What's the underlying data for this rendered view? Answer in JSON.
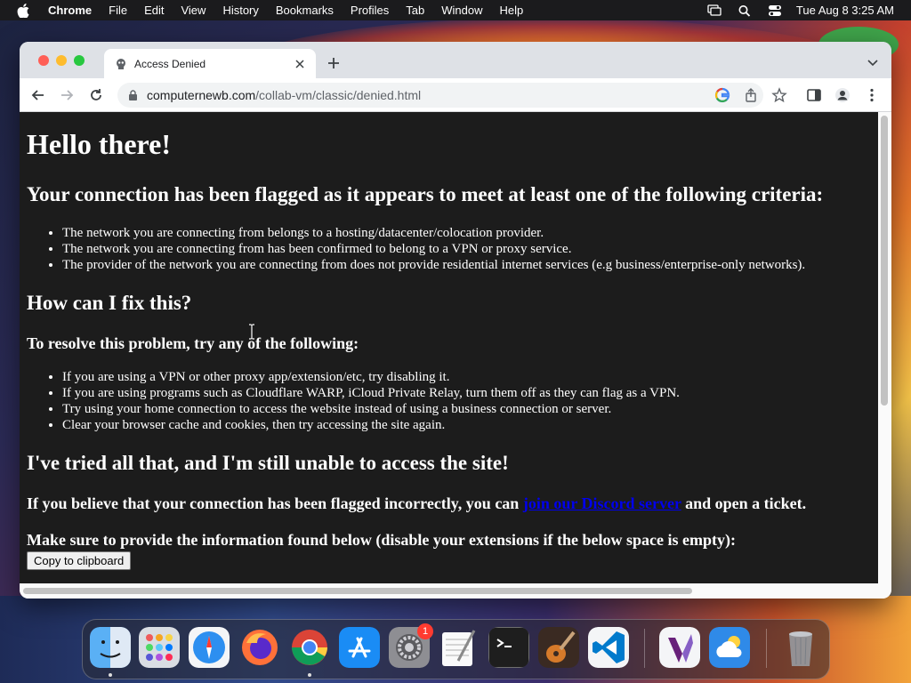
{
  "menubar": {
    "app_name": "Chrome",
    "items": [
      "File",
      "Edit",
      "View",
      "History",
      "Bookmarks",
      "Profiles",
      "Tab",
      "Window",
      "Help"
    ],
    "clock": "Tue Aug 8  3:25 AM"
  },
  "browser": {
    "tab_title": "Access Denied",
    "url_domain": "computernewb.com",
    "url_path": "/collab-vm/classic/denied.html"
  },
  "page": {
    "heading": "Hello there!",
    "criteria_heading": "Your connection has been flagged as it appears to meet at least one of the following criteria:",
    "criteria": [
      "The network you are connecting from belongs to a hosting/datacenter/colocation provider.",
      "The network you are connecting from has been confirmed to belong to a VPN or proxy service.",
      "The provider of the network you are connecting from does not provide residential internet services (e.g business/enterprise-only networks)."
    ],
    "fix_heading": "How can I fix this?",
    "resolve_heading": "To resolve this problem, try any of the following:",
    "steps": [
      "If you are using a VPN or other proxy app/extension/etc, try disabling it.",
      "If you are using programs such as Cloudflare WARP, iCloud Private Relay, turn them off as they can flag as a VPN.",
      "Try using your home connection to access the website instead of using a business connection or server.",
      "Clear your browser cache and cookies, then try accessing the site again."
    ],
    "still_heading": "I've tried all that, and I'm still unable to access the site!",
    "incorrect_prefix": "If you believe that your connection has been flagged incorrectly, you can ",
    "discord_link": "join our Discord server",
    "incorrect_suffix": " and open a ticket.",
    "provide_info": "Make sure to provide the information found below (disable your extensions if the below space is empty):",
    "copy_button": "Copy to clipboard"
  },
  "dock": {
    "icons": [
      "finder-icon",
      "launchpad-icon",
      "safari-icon",
      "firefox-icon",
      "chrome-icon",
      "app-store-icon",
      "system-settings-icon",
      "textedit-icon",
      "terminal-icon",
      "garageband-icon",
      "vscode-icon",
      "visual-studio-icon",
      "weather-icon",
      "trash-icon"
    ],
    "settings_badge": "1"
  }
}
